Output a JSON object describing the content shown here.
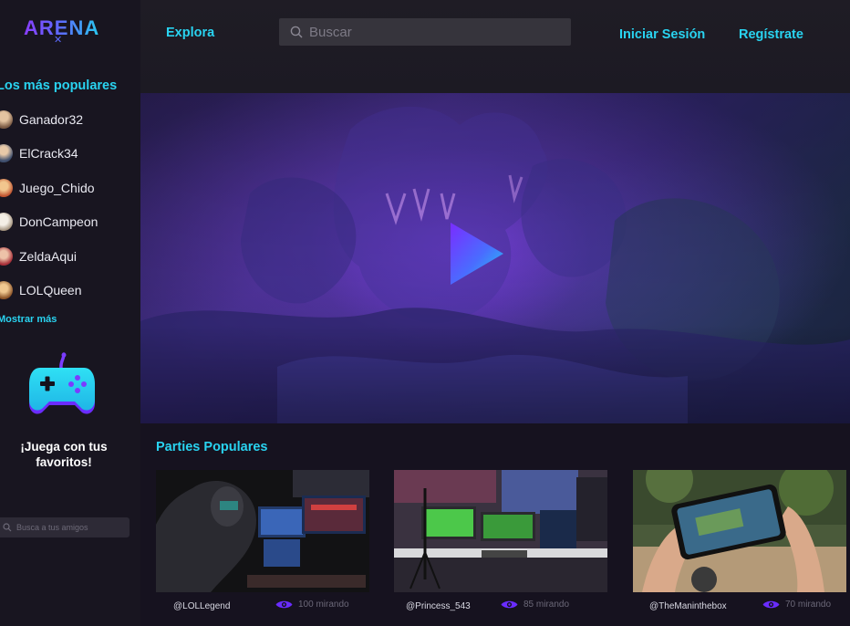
{
  "brand": {
    "name": "ARENA",
    "mark": "✕"
  },
  "sidebar": {
    "popular_title": "Los más populares",
    "users": [
      {
        "name": "Ganador32",
        "avatar_color": "#a07a5a"
      },
      {
        "name": "ElCrack34",
        "avatar_color": "#5c6e8c"
      },
      {
        "name": "Juego_Chido",
        "avatar_color": "#c28a4e"
      },
      {
        "name": "DonCampeon",
        "avatar_color": "#d8d2c8"
      },
      {
        "name": "ZeldaAqui",
        "avatar_color": "#b84a4a"
      },
      {
        "name": "LOLQueen",
        "avatar_color": "#9c6a3c"
      }
    ],
    "show_more": "Mostrar más",
    "promo_text": "¡Juega con tus favoritos!",
    "friend_search_placeholder": "Busca a tus amigos"
  },
  "topbar": {
    "explore": "Explora",
    "search_placeholder": "Buscar",
    "login": "Iniciar Sesión",
    "register": "Regístrate"
  },
  "parties": {
    "title": "Parties Populares",
    "cards": [
      {
        "handle": "@LOLLegend",
        "viewers": "100 mirando"
      },
      {
        "handle": "@Princess_543",
        "viewers": "85 mirando"
      },
      {
        "handle": "@TheManinthebox",
        "viewers": "70 mirando"
      }
    ]
  },
  "colors": {
    "accent": "#29d3f0",
    "brand_gradient": [
      "#8a3dff",
      "#29c9f0"
    ],
    "sidebar_bg": "#181520",
    "topbar_bg": "#1f1c25",
    "eye_icon": "#6a2cff"
  }
}
